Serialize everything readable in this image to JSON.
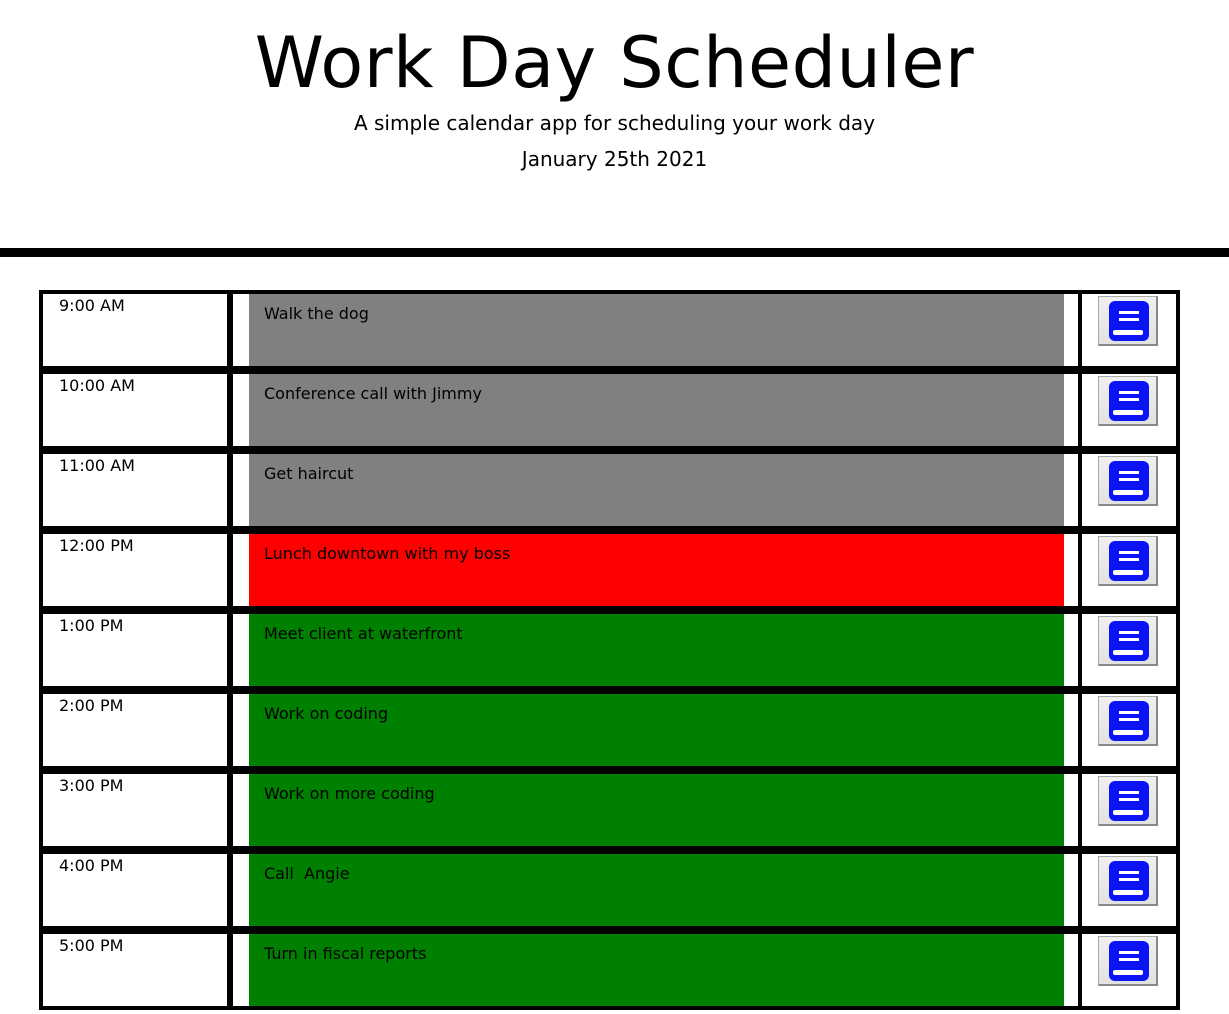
{
  "header": {
    "title": "Work Day Scheduler",
    "lead": "A simple calendar app for scheduling your work day",
    "date": "January 25th 2021"
  },
  "colors": {
    "past": "#808080",
    "present": "#ff0000",
    "future": "#008000",
    "save_icon": "#0a14f5"
  },
  "save_icon": "save-book-icon",
  "rows": [
    {
      "hour": "9:00 AM",
      "text": "Walk the dog",
      "state": "past"
    },
    {
      "hour": "10:00 AM",
      "text": "Conference call with Jimmy",
      "state": "past"
    },
    {
      "hour": "11:00 AM",
      "text": "Get haircut",
      "state": "past"
    },
    {
      "hour": "12:00 PM",
      "text": "Lunch downtown with my boss",
      "state": "present"
    },
    {
      "hour": "1:00 PM",
      "text": "Meet client at waterfront",
      "state": "future"
    },
    {
      "hour": "2:00 PM",
      "text": "Work on coding",
      "state": "future"
    },
    {
      "hour": "3:00 PM",
      "text": "Work on more coding",
      "state": "future"
    },
    {
      "hour": "4:00 PM",
      "text": "Call  Angie",
      "state": "future"
    },
    {
      "hour": "5:00 PM",
      "text": "Turn in fiscal reports",
      "state": "future"
    }
  ]
}
